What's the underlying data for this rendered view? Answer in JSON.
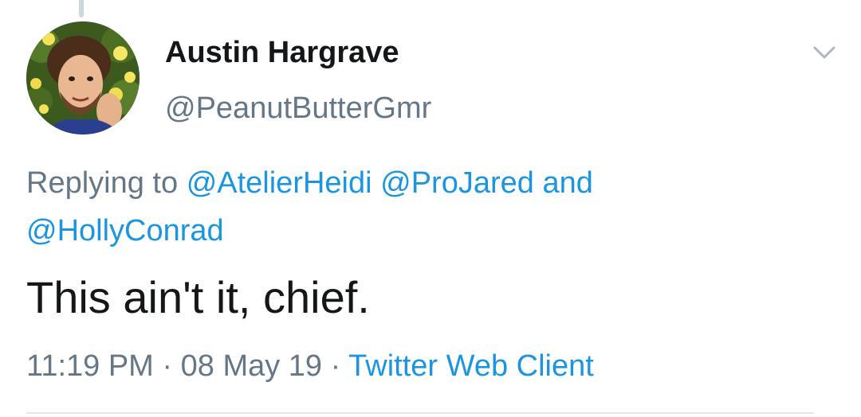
{
  "tweet": {
    "author": {
      "display_name": "Austin Hargrave",
      "handle": "@PeanutButterGmr",
      "avatar_icon": "user-avatar-photo"
    },
    "menu_icon": "chevron-down-icon",
    "reply": {
      "prefix": "Replying to",
      "mentions": [
        "@AtelierHeidi",
        "@ProJared"
      ],
      "conjunction": "and",
      "last_mention": "@HollyConrad"
    },
    "text": "This ain't it, chief.",
    "meta": {
      "time": "11:19 PM",
      "separator": "·",
      "date": "08 May 19",
      "source": "Twitter Web Client"
    }
  },
  "colors": {
    "text": "#14171a",
    "secondary": "#657786",
    "link": "#1b95e0",
    "divider": "#e1e8ed"
  }
}
